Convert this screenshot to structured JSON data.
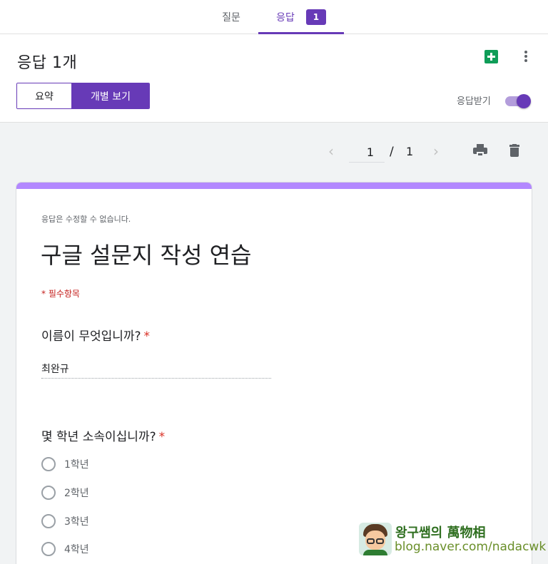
{
  "tabs": {
    "questions_label": "질문",
    "responses_label": "응답",
    "responses_badge": "1"
  },
  "summary": {
    "count_title": "응답 1개",
    "view_summary_label": "요약",
    "view_individual_label": "개별 보기",
    "accepting_label": "응답받기",
    "accepting_on": true
  },
  "pager": {
    "current": "1",
    "separator": "/",
    "total": "1"
  },
  "form": {
    "note": "응답은 수정할 수 없습니다.",
    "title": "구글 설문지 작성 연습",
    "required_note": "* 필수항목",
    "accent_color": "#b388ff",
    "questions": [
      {
        "title": "이름이 무엇입니까?",
        "required_mark": "*",
        "answer": "최완규"
      },
      {
        "title": "몇 학년 소속이십니까?",
        "required_mark": "*",
        "options": [
          "1학년",
          "2학년",
          "3학년",
          "4학년"
        ]
      }
    ]
  },
  "watermark": {
    "title": "왕구쌤의 萬物相",
    "url": "blog.naver.com/nadacwk"
  },
  "colors": {
    "primary": "#673ab7",
    "sheets_green": "#0f9d58",
    "required_red": "#d93025"
  }
}
